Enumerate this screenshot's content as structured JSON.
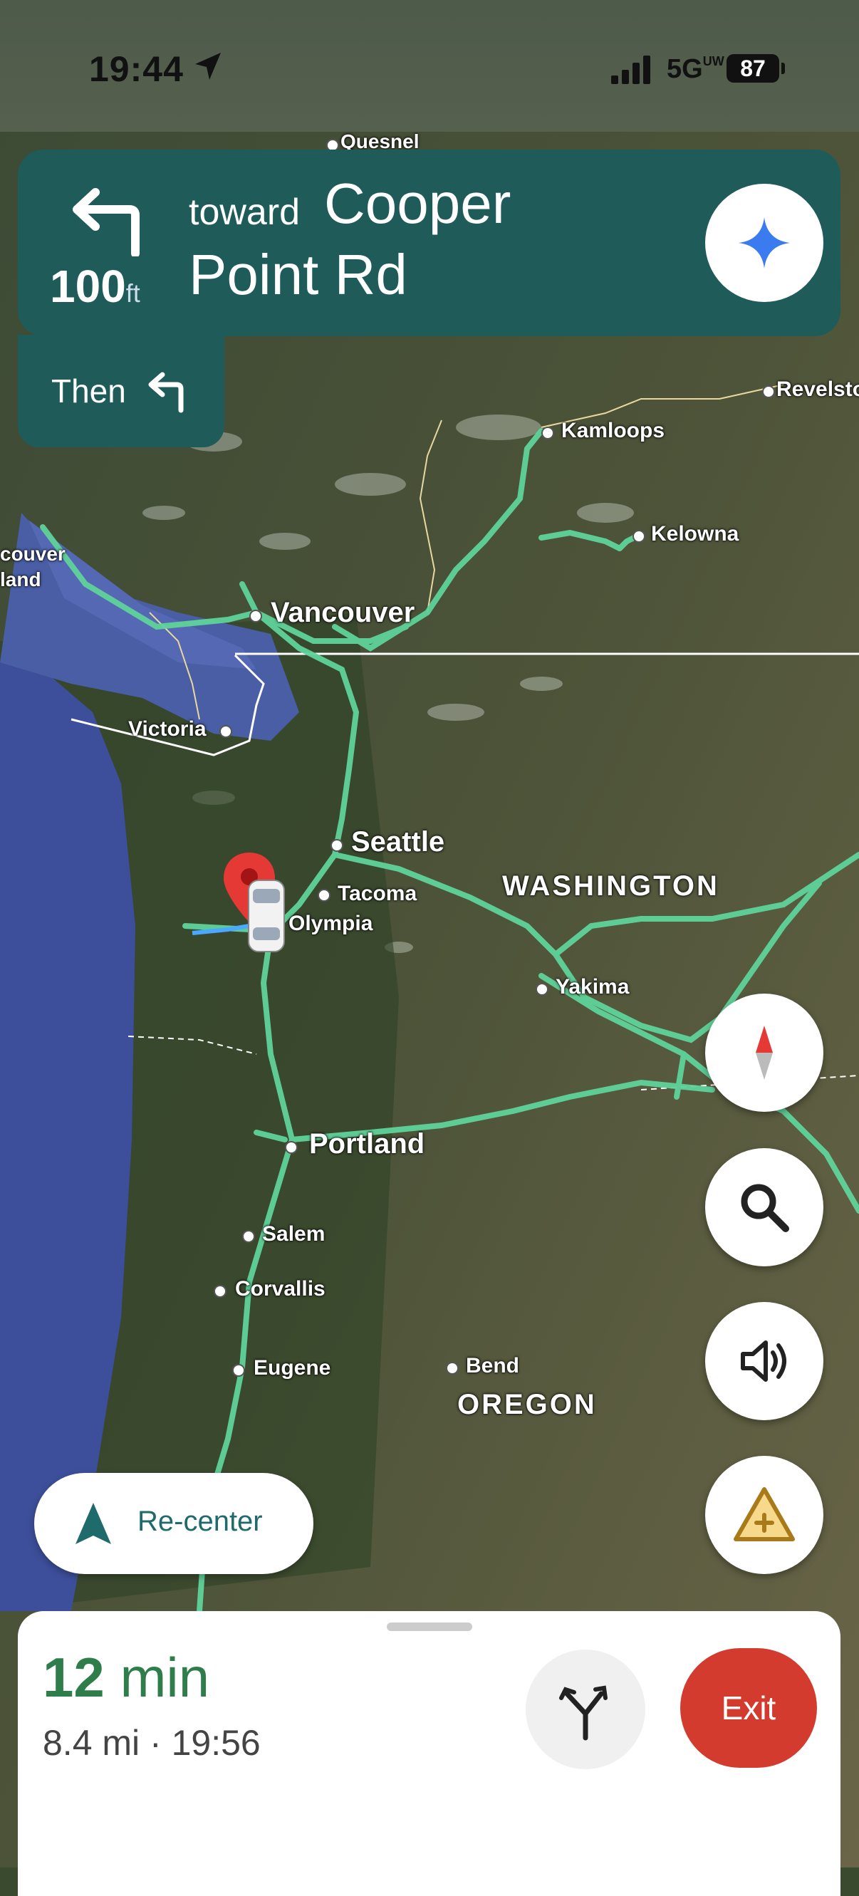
{
  "status_bar": {
    "time": "19:44",
    "network": "5G",
    "network_sub": "UW",
    "battery": "87"
  },
  "navigation": {
    "distance_value": "100",
    "distance_unit": "ft",
    "toward": "toward",
    "street_first": "Cooper",
    "street_second": "Point Rd",
    "then_label": "Then"
  },
  "map_labels": {
    "quesnel": "Quesnel",
    "kamloops": "Kamloops",
    "revelstoke": "Revelsto",
    "kelowna": "Kelowna",
    "vancouver": "Vancouver",
    "vancouver_island_1": "couver",
    "vancouver_island_2": "land",
    "victoria": "Victoria",
    "seattle": "Seattle",
    "tacoma": "Tacoma",
    "olympia": "Olympia",
    "washington": "WASHINGTON",
    "yakima": "Yakima",
    "portland": "Portland",
    "salem": "Salem",
    "corvallis": "Corvallis",
    "eugene": "Eugene",
    "bend": "Bend",
    "oregon": "OREGON"
  },
  "controls": {
    "recenter_label": "Re-center",
    "exit_label": "Exit"
  },
  "trip": {
    "minutes_value": "12",
    "minutes_unit": "min",
    "details": "8.4 mi · 19:56"
  },
  "colors": {
    "nav_card": "#1f5c59",
    "route": "#5fd39a",
    "exit": "#d33b2e",
    "eta": "#2e7d4a"
  },
  "icons": [
    "location-arrow-icon",
    "signal-icon",
    "turn-left-icon",
    "gemini-sparkle-icon",
    "compass-icon",
    "search-icon",
    "volume-icon",
    "report-incident-icon",
    "navigation-arrow-icon",
    "alternate-routes-icon",
    "destination-pin-icon",
    "car-icon"
  ]
}
